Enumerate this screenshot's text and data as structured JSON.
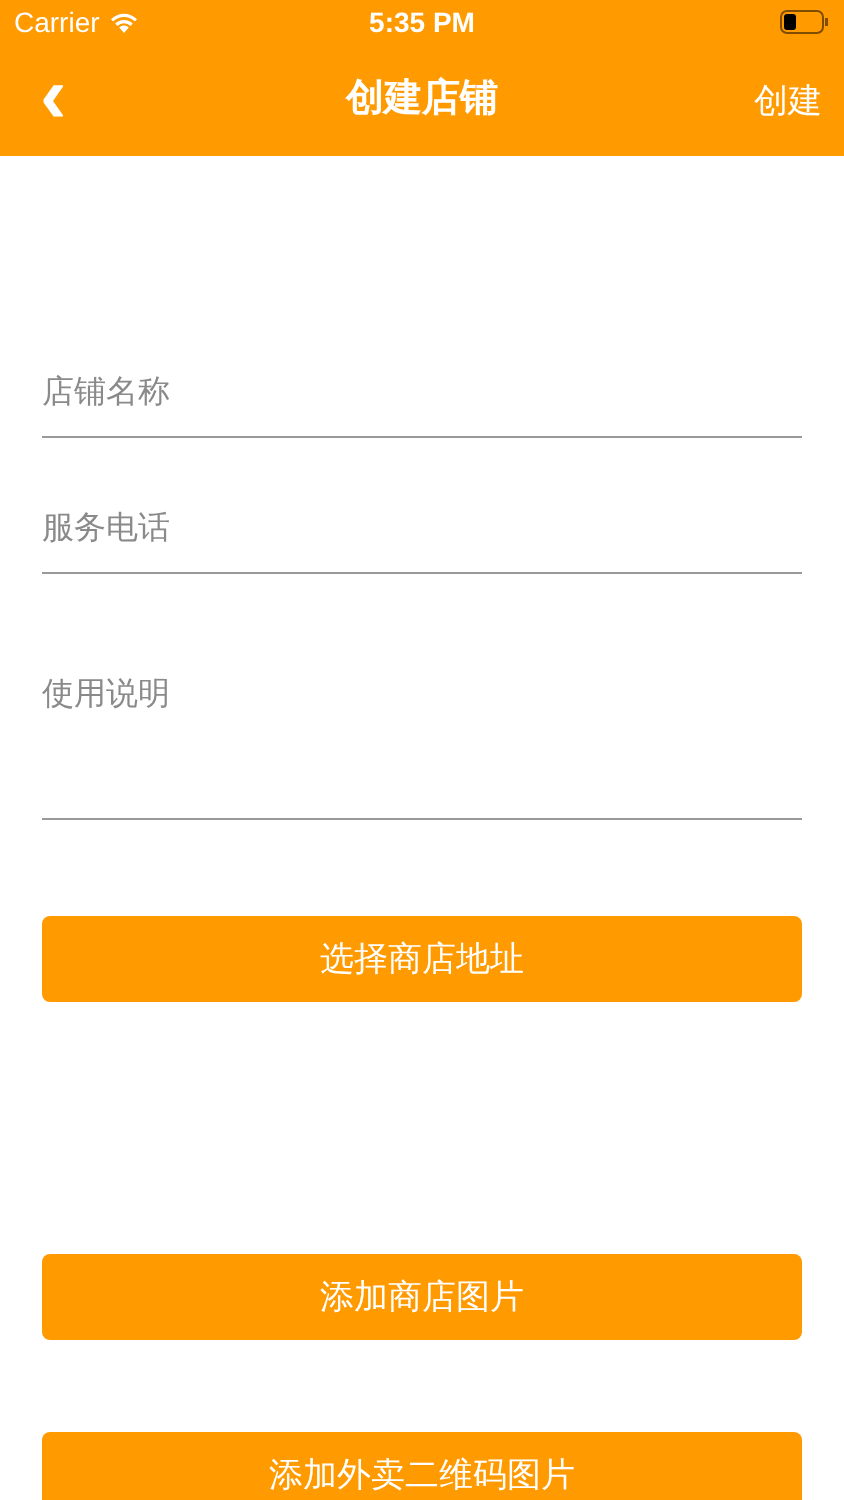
{
  "status_bar": {
    "carrier": "Carrier",
    "time": "5:35 PM"
  },
  "nav_bar": {
    "back": "‹",
    "title": "创建店铺",
    "action": "创建"
  },
  "fields": [
    {
      "kind": "input",
      "placeholder": "店铺名称"
    },
    {
      "kind": "input",
      "placeholder": "服务电话"
    },
    {
      "kind": "textarea",
      "placeholder": "使用说明"
    }
  ],
  "buttons": [
    {
      "label": "选择商店地址"
    },
    {
      "label": "添加商店图片"
    },
    {
      "label": "添加外卖二维码图片"
    }
  ]
}
